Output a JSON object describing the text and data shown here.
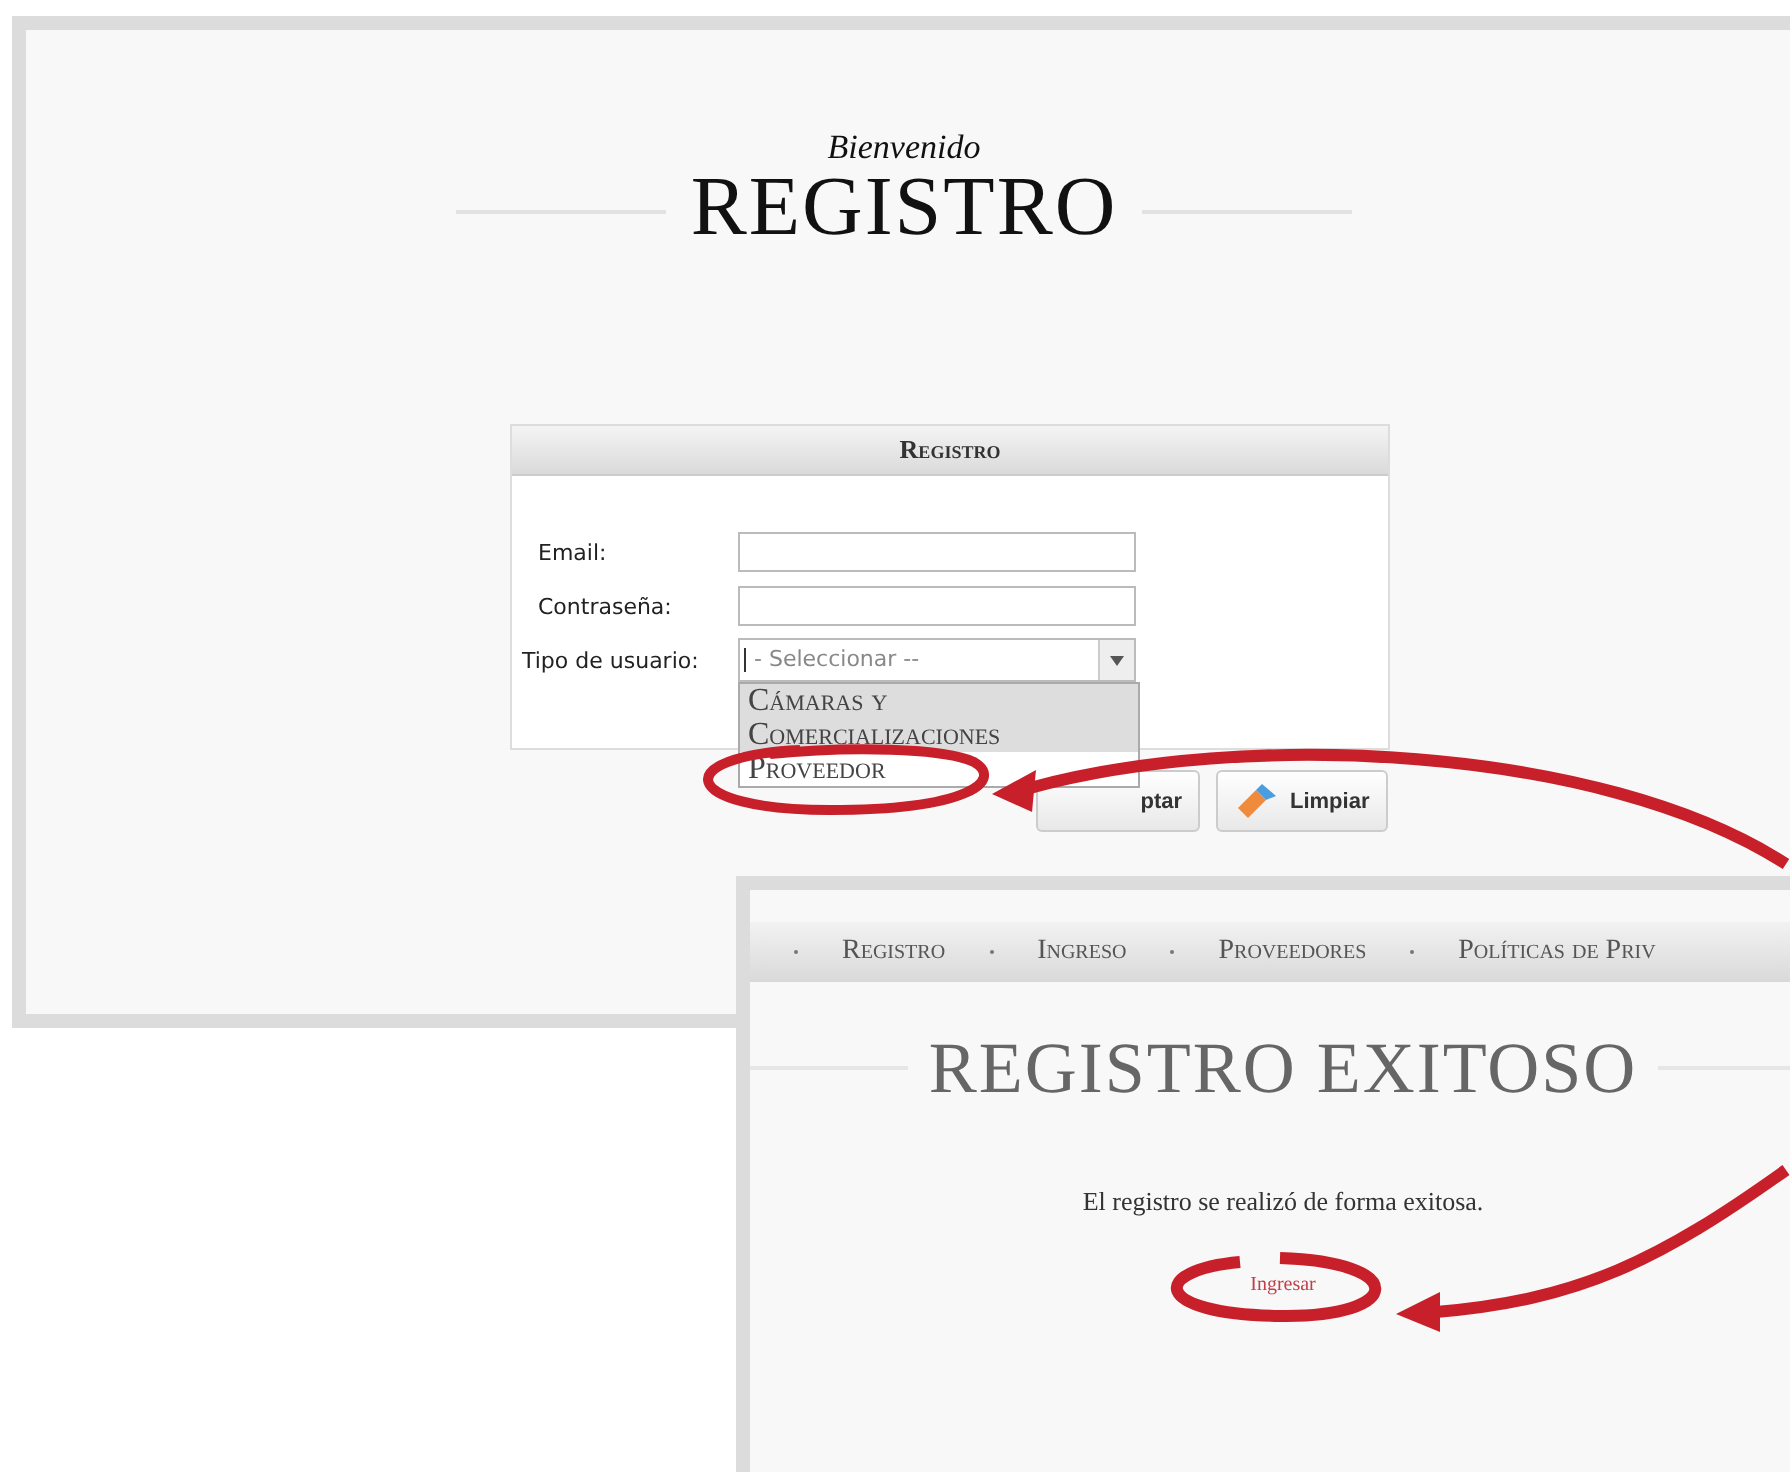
{
  "registration_page": {
    "subtitle": "Bienvenido",
    "title": "REGISTRO",
    "form": {
      "header": "Registro",
      "fields": [
        {
          "kind": "text",
          "label": "Email:"
        },
        {
          "kind": "password",
          "label": "Contraseña:"
        },
        {
          "kind": "select",
          "label": "Tipo de usuario:",
          "value": "- Seleccionar --",
          "expanded": true
        }
      ],
      "options": [
        {
          "label": "Cámaras y Comercializaciones",
          "selected": true
        },
        {
          "label": "Proveedor",
          "selected": false
        }
      ],
      "buttons": [
        {
          "kind": "accept",
          "label": "ptar"
        },
        {
          "kind": "clear",
          "label": "Limpiar"
        }
      ]
    }
  },
  "success_page": {
    "nav": [
      "Registro",
      "Ingreso",
      "Proveedores",
      "Políticas de Priv"
    ],
    "title": "REGISTRO EXITOSO",
    "message": "El registro se realizó de forma exitosa.",
    "link": "Ingresar"
  }
}
